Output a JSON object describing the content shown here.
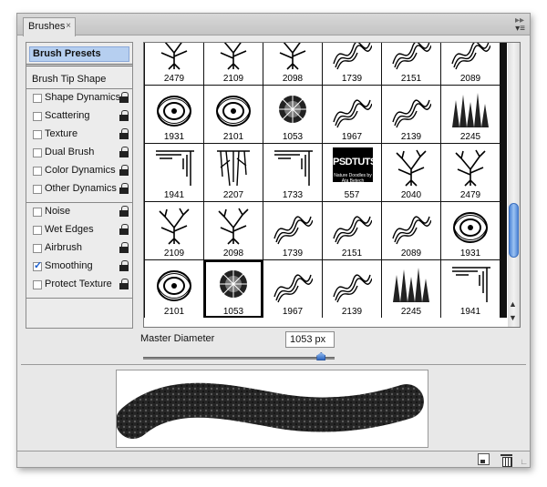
{
  "panel": {
    "tab_label": "Brushes",
    "tab_close": "×"
  },
  "sidebar": {
    "header": "Brush Presets",
    "tip_shape": "Brush Tip Shape",
    "group1": [
      {
        "label": "Shape Dynamics",
        "checked": false
      },
      {
        "label": "Scattering",
        "checked": false
      },
      {
        "label": "Texture",
        "checked": false
      },
      {
        "label": "Dual Brush",
        "checked": false
      },
      {
        "label": "Color Dynamics",
        "checked": false
      },
      {
        "label": "Other Dynamics",
        "checked": false
      }
    ],
    "group2": [
      {
        "label": "Noise",
        "checked": false
      },
      {
        "label": "Wet Edges",
        "checked": false
      },
      {
        "label": "Airbrush",
        "checked": false
      },
      {
        "label": "Smoothing",
        "checked": true
      },
      {
        "label": "Protect Texture",
        "checked": false
      }
    ]
  },
  "presets": [
    {
      "num": "2479",
      "kind": "tree"
    },
    {
      "num": "2109",
      "kind": "tree"
    },
    {
      "num": "2098",
      "kind": "tree"
    },
    {
      "num": "1739",
      "kind": "wave"
    },
    {
      "num": "2151",
      "kind": "wave"
    },
    {
      "num": "2089",
      "kind": "wave"
    },
    {
      "num": "1931",
      "kind": "swirl"
    },
    {
      "num": "2101",
      "kind": "swirl"
    },
    {
      "num": "1053",
      "kind": "burst"
    },
    {
      "num": "1967",
      "kind": "wave"
    },
    {
      "num": "2139",
      "kind": "wave"
    },
    {
      "num": "2245",
      "kind": "grass"
    },
    {
      "num": "1941",
      "kind": "corner"
    },
    {
      "num": "2207",
      "kind": "roots"
    },
    {
      "num": "1733",
      "kind": "corner"
    },
    {
      "num": "557",
      "kind": "logo"
    },
    {
      "num": "2040",
      "kind": "tree"
    },
    {
      "num": "2479",
      "kind": "tree"
    },
    {
      "num": "2109",
      "kind": "tree"
    },
    {
      "num": "2098",
      "kind": "tree"
    },
    {
      "num": "1739",
      "kind": "wave"
    },
    {
      "num": "2151",
      "kind": "wave"
    },
    {
      "num": "2089",
      "kind": "wave"
    },
    {
      "num": "1931",
      "kind": "swirl"
    },
    {
      "num": "2101",
      "kind": "swirl"
    },
    {
      "num": "1053",
      "kind": "burst",
      "selected": true
    },
    {
      "num": "1967",
      "kind": "wave"
    },
    {
      "num": "2139",
      "kind": "wave"
    },
    {
      "num": "2245",
      "kind": "grass"
    },
    {
      "num": "1941",
      "kind": "corner"
    }
  ],
  "logo_text": {
    "big": "PSDTUTS",
    "small": "Nature Doodles by Ata Betech"
  },
  "master": {
    "label": "Master Diameter",
    "value": "1053 px",
    "slider_fraction": 0.93
  },
  "icons": {
    "new_brush": "new-brush-icon",
    "delete": "trash-icon",
    "menu": "panel-menu-icon"
  }
}
